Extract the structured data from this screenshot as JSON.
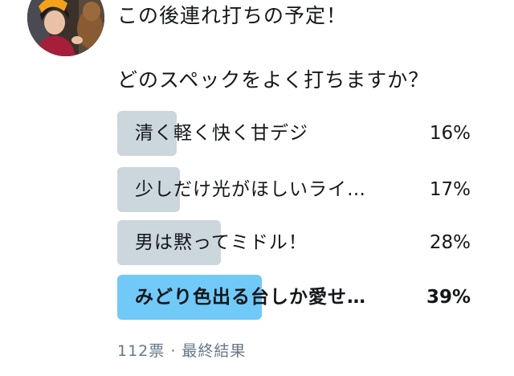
{
  "tweet": {
    "line1": "この後連れ打ちの予定！",
    "line2": "どのスペックをよく打ちますか？"
  },
  "poll": {
    "options": [
      {
        "label": "清く軽く快く甘デジ",
        "percent_text": "16%",
        "percent": 16,
        "winner": false
      },
      {
        "label": "少しだけ光がほしいライ…",
        "percent_text": "17%",
        "percent": 17,
        "winner": false
      },
      {
        "label": "男は黙ってミドル！",
        "percent_text": "28%",
        "percent": 28,
        "winner": false
      },
      {
        "label": "みどり色出る台しか愛せ…",
        "percent_text": "39%",
        "percent": 39,
        "winner": true
      }
    ],
    "votes": "112票",
    "separator": "·",
    "status": "最終結果"
  },
  "colors": {
    "bar": "#ccd6dd",
    "winner_bar": "#71c9f8",
    "meta_text": "#657786"
  }
}
